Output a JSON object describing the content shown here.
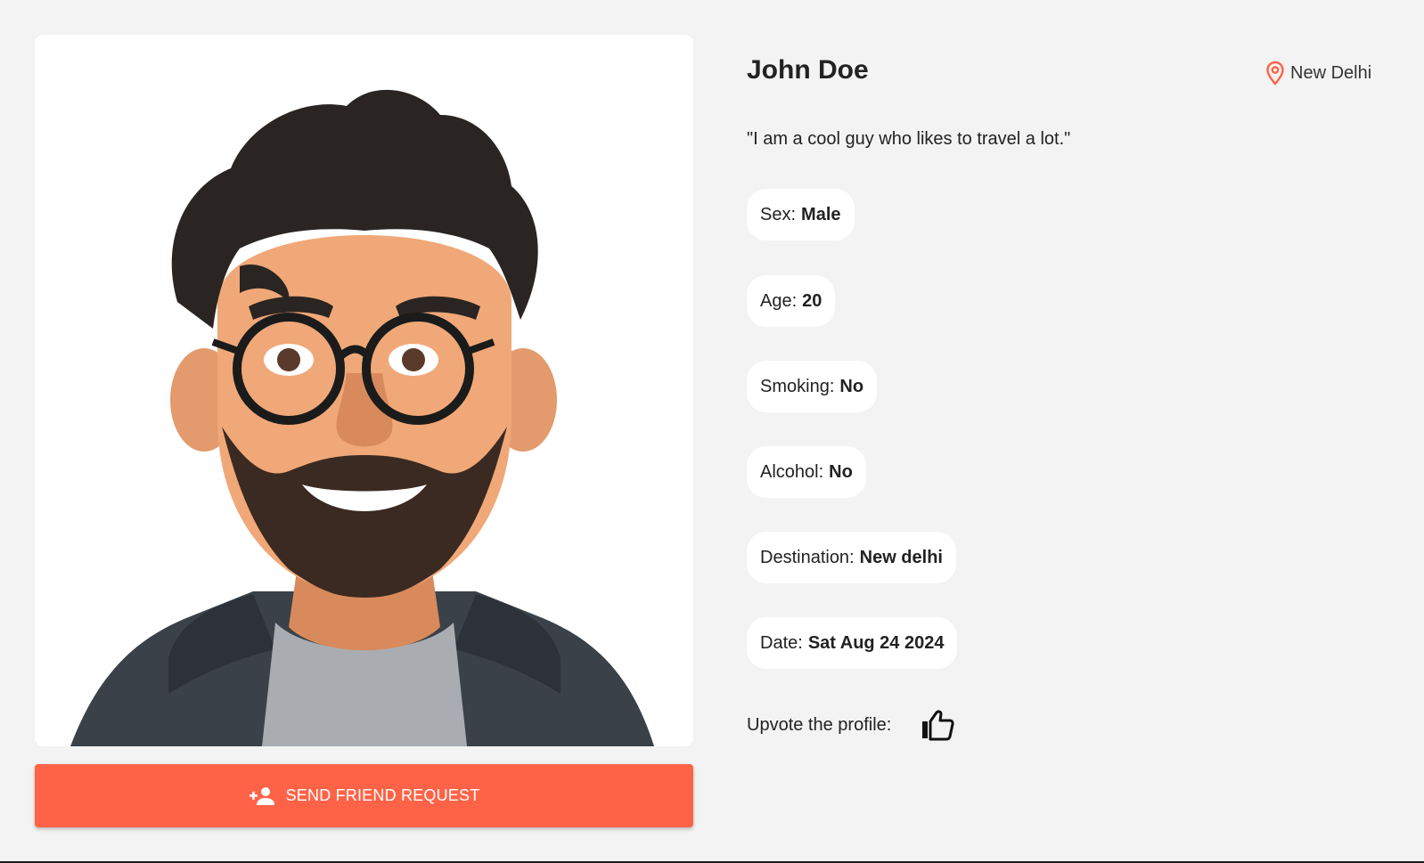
{
  "profile": {
    "name": "John Doe",
    "location": "New Delhi",
    "bio": "\"I am a cool guy who likes to travel a lot.\"",
    "details": [
      {
        "label": "Sex:",
        "value": "Male"
      },
      {
        "label": "Age:",
        "value": "20"
      },
      {
        "label": "Smoking:",
        "value": "No"
      },
      {
        "label": "Alcohol:",
        "value": "No"
      },
      {
        "label": "Destination:",
        "value": "New delhi"
      },
      {
        "label": "Date:",
        "value": "Sat Aug 24 2024"
      }
    ],
    "upvote_label": "Upvote the profile:"
  },
  "actions": {
    "friend_request_label": "SEND FRIEND REQUEST"
  },
  "icons": {
    "location": "location-pin-icon",
    "friend_request": "person-add-icon",
    "upvote": "thumb-up-icon"
  },
  "colors": {
    "accent": "#ff6347",
    "background": "#f3f3f3",
    "card": "#ffffff"
  }
}
